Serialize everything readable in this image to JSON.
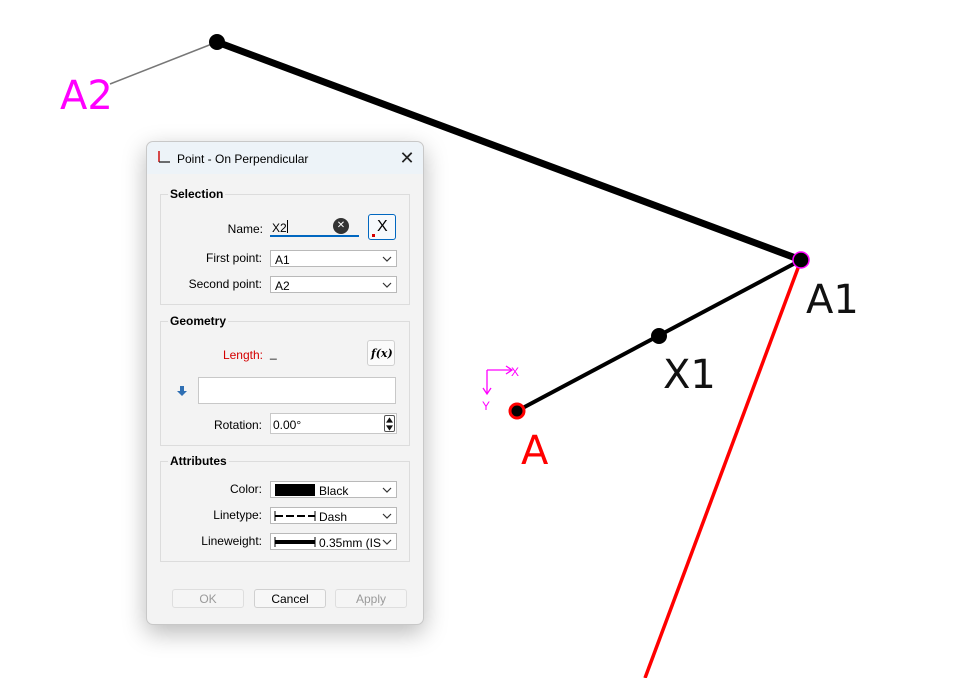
{
  "canvas": {
    "labels": {
      "a2": "A2",
      "a1": "A1",
      "x1": "X1",
      "a": "A"
    },
    "axes": {
      "x": "X",
      "y": "Y"
    },
    "colors": {
      "line": "#000000",
      "red": "#ff0000",
      "magenta": "#ff00ff",
      "leader": "#777777"
    }
  },
  "dialog": {
    "title": "Point - On Perpendicular",
    "close_glyph": "✕",
    "selection": {
      "title": "Selection",
      "name_label": "Name:",
      "name_value": "X2",
      "clear_glyph": "✕",
      "pick_label": "X",
      "first_point_label": "First point:",
      "first_point_value": "A1",
      "second_point_label": "Second point:",
      "second_point_value": "A2"
    },
    "geometry": {
      "title": "Geometry",
      "length_label": "Length:",
      "length_value": "_",
      "fx_label": "f(x)",
      "formula_value": "",
      "rotation_label": "Rotation:",
      "rotation_value": "0.00°"
    },
    "attributes": {
      "title": "Attributes",
      "color_label": "Color:",
      "color_value": "Black",
      "linetype_label": "Linetype:",
      "linetype_value": "Dash",
      "lineweight_label": "Lineweight:",
      "lineweight_value": "0.35mm (IS"
    },
    "buttons": {
      "ok": "OK",
      "cancel": "Cancel",
      "apply": "Apply"
    },
    "colors": {
      "accent": "#0067c0",
      "error": "#d40000",
      "title_bar": "#edf3f8"
    }
  }
}
